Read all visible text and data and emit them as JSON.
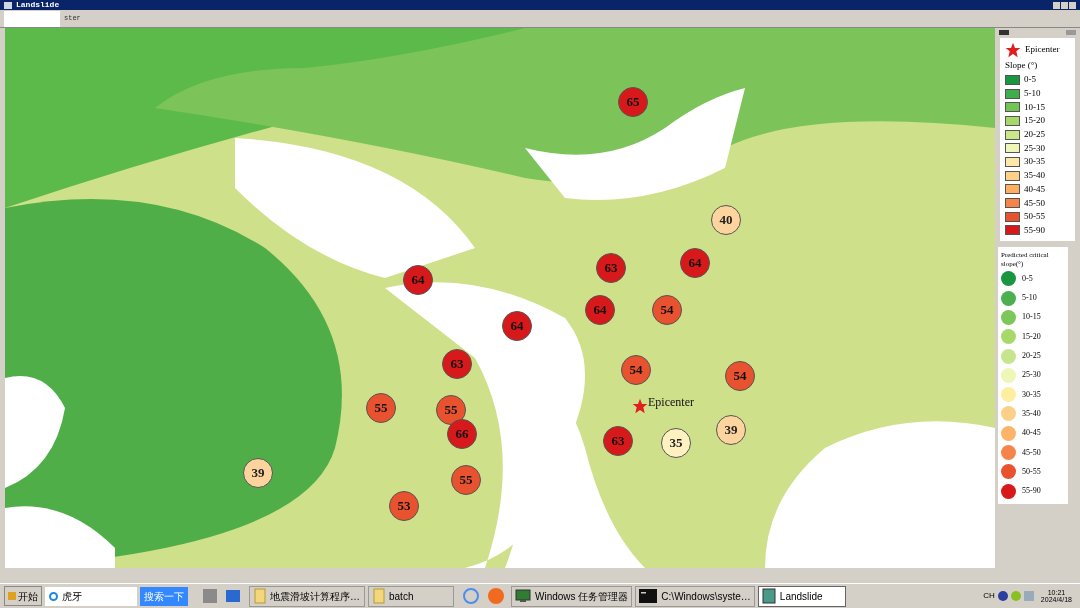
{
  "window": {
    "title": "Landslide",
    "tab": "ster"
  },
  "map": {
    "epicenter_label": "Epicenter",
    "markers": [
      {
        "value": "65",
        "color": "#d7191c"
      },
      {
        "value": "40",
        "color": "#fdd49e"
      },
      {
        "value": "64",
        "color": "#d7191c"
      },
      {
        "value": "63",
        "color": "#d7191c"
      },
      {
        "value": "64",
        "color": "#d7191c"
      },
      {
        "value": "64",
        "color": "#d7191c"
      },
      {
        "value": "64",
        "color": "#d7191c"
      },
      {
        "value": "54",
        "color": "#e8522f"
      },
      {
        "value": "63",
        "color": "#d7191c"
      },
      {
        "value": "54",
        "color": "#e8522f"
      },
      {
        "value": "54",
        "color": "#e8522f"
      },
      {
        "value": "55",
        "color": "#e8522f"
      },
      {
        "value": "55",
        "color": "#e8522f"
      },
      {
        "value": "66",
        "color": "#d7191c"
      },
      {
        "value": "35",
        "color": "#fff2c0"
      },
      {
        "value": "39",
        "color": "#fdd49e"
      },
      {
        "value": "63",
        "color": "#d7191c"
      },
      {
        "value": "39",
        "color": "#fdd49e"
      },
      {
        "value": "55",
        "color": "#e8522f"
      },
      {
        "value": "53",
        "color": "#e8522f"
      }
    ]
  },
  "legend": {
    "epicenter": "Epicenter",
    "slope_title": "Slope (°)",
    "slope_classes": [
      {
        "label": "0-5",
        "color": "#1a9641"
      },
      {
        "label": "5-10",
        "color": "#3fae4a"
      },
      {
        "label": "10-15",
        "color": "#73c454"
      },
      {
        "label": "15-20",
        "color": "#a6d96a"
      },
      {
        "label": "20-25",
        "color": "#c9e68a"
      },
      {
        "label": "25-30",
        "color": "#eef6b8"
      },
      {
        "label": "30-35",
        "color": "#fee8a8"
      },
      {
        "label": "35-40",
        "color": "#fdd08a"
      },
      {
        "label": "40-45",
        "color": "#fdae61"
      },
      {
        "label": "45-50",
        "color": "#f4844a"
      },
      {
        "label": "50-55",
        "color": "#e8522f"
      },
      {
        "label": "55-90",
        "color": "#d7191c"
      }
    ],
    "critical_title": "Predicted critical slope(°)",
    "critical_classes": [
      {
        "label": "0-5",
        "color": "#1a9641"
      },
      {
        "label": "5-10",
        "color": "#4caf50"
      },
      {
        "label": "10-15",
        "color": "#7cc75a"
      },
      {
        "label": "15-20",
        "color": "#a6d96a"
      },
      {
        "label": "20-25",
        "color": "#c6e58e"
      },
      {
        "label": "25-30",
        "color": "#eef6b8"
      },
      {
        "label": "30-35",
        "color": "#fdeea0"
      },
      {
        "label": "35-40",
        "color": "#fdd08a"
      },
      {
        "label": "40-45",
        "color": "#fdb468"
      },
      {
        "label": "45-50",
        "color": "#f4844a"
      },
      {
        "label": "50-55",
        "color": "#e8522f"
      },
      {
        "label": "55-90",
        "color": "#d7191c"
      }
    ]
  },
  "taskbar": {
    "start": "开始",
    "address": "虎牙",
    "search_button": "搜索一下",
    "tasks": [
      {
        "label": "地震滑坡计算程序…",
        "kind": "folder",
        "selected": false
      },
      {
        "label": "batch",
        "kind": "folder",
        "selected": false
      },
      {
        "label": "Windows 任务管理器",
        "kind": "monitor",
        "selected": false
      },
      {
        "label": "C:\\Windows\\syste…",
        "kind": "console",
        "selected": false
      },
      {
        "label": "Landslide",
        "kind": "app",
        "selected": true
      }
    ],
    "language": "CH",
    "time": "10:21",
    "date": "2024/4/18"
  }
}
